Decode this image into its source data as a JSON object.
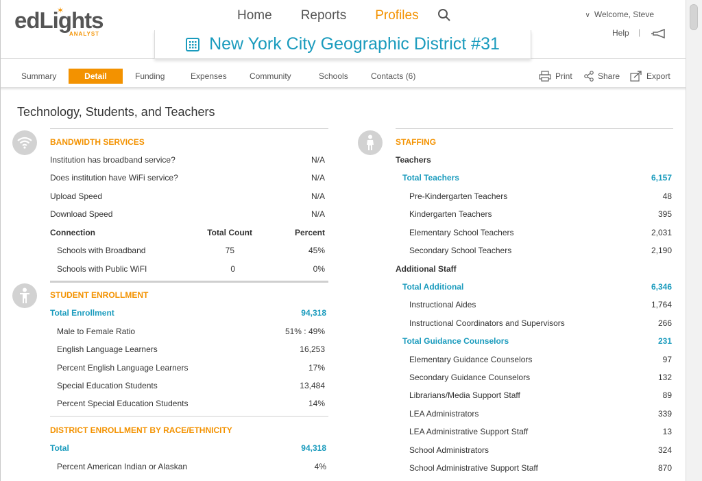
{
  "logo": {
    "main": "edLights",
    "sub": "ANALYST"
  },
  "topnav": {
    "items": [
      "Home",
      "Reports",
      "Profiles"
    ],
    "active": "Profiles"
  },
  "user": {
    "welcome": "Welcome, Steve",
    "help": "Help",
    "separator": "|"
  },
  "page_title": "New York City Geographic District #31",
  "subnav": {
    "tabs": [
      "Summary",
      "Detail",
      "Funding",
      "Expenses",
      "Community",
      "Schools",
      "Contacts (6)"
    ],
    "active": "Detail",
    "actions": [
      "Print",
      "Share",
      "Export"
    ]
  },
  "section_title": "Technology, Students, and Teachers",
  "bandwidth": {
    "heading": "BANDWIDTH SERVICES",
    "rows": [
      {
        "label": "Institution has broadband service?",
        "value": "N/A"
      },
      {
        "label": "Does institution have WiFi service?",
        "value": "N/A"
      },
      {
        "label": "Upload Speed",
        "value": "N/A"
      },
      {
        "label": "Download Speed",
        "value": "N/A"
      }
    ],
    "connection_header": {
      "label": "Connection",
      "count": "Total Count",
      "percent": "Percent"
    },
    "connection_rows": [
      {
        "label": "Schools with Broadband",
        "count": "75",
        "percent": "45%"
      },
      {
        "label": "Schools with Public WiFI",
        "count": "0",
        "percent": "0%"
      }
    ]
  },
  "enrollment": {
    "heading": "STUDENT ENROLLMENT",
    "total": {
      "label": "Total Enrollment",
      "value": "94,318"
    },
    "rows": [
      {
        "label": "Male to Female Ratio",
        "value": "51% : 49%"
      },
      {
        "label": "English Language Learners",
        "value": "16,253"
      },
      {
        "label": "Percent English Language Learners",
        "value": "17%"
      },
      {
        "label": "Special Education Students",
        "value": "13,484"
      },
      {
        "label": "Percent Special Education Students",
        "value": "14%"
      }
    ]
  },
  "race": {
    "heading": "DISTRICT ENROLLMENT BY RACE/ETHNICITY",
    "total": {
      "label": "Total",
      "value": "94,318"
    },
    "rows": [
      {
        "label": "Percent American Indian or Alaskan",
        "value": "4%"
      }
    ]
  },
  "staffing": {
    "heading": "STAFFING",
    "teachers_label": "Teachers",
    "total_teachers": {
      "label": "Total Teachers",
      "value": "6,157"
    },
    "teacher_rows": [
      {
        "label": "Pre-Kindergarten Teachers",
        "value": "48"
      },
      {
        "label": "Kindergarten Teachers",
        "value": "395"
      },
      {
        "label": "Elementary School Teachers",
        "value": "2,031"
      },
      {
        "label": "Secondary School Teachers",
        "value": "2,190"
      }
    ],
    "additional_label": "Additional Staff",
    "total_additional": {
      "label": "Total Additional",
      "value": "6,346"
    },
    "additional_rows": [
      {
        "label": "Instructional Aides",
        "value": "1,764"
      },
      {
        "label": "Instructional Coordinators and Supervisors",
        "value": "266"
      }
    ],
    "total_guidance": {
      "label": "Total Guidance Counselors",
      "value": "231"
    },
    "guidance_rows": [
      {
        "label": "Elementary Guidance Counselors",
        "value": "97"
      },
      {
        "label": "Secondary Guidance Counselors",
        "value": "132"
      },
      {
        "label": "Librarians/Media Support Staff",
        "value": "89"
      },
      {
        "label": "LEA Administrators",
        "value": "339"
      },
      {
        "label": "LEA Administrative Support Staff",
        "value": "13"
      },
      {
        "label": "School Administrators",
        "value": "324"
      },
      {
        "label": "School Administrative Support Staff",
        "value": "870"
      }
    ]
  },
  "colors": {
    "accent": "#f39200",
    "teal": "#1a9bbd",
    "icon_bg": "#d2d2d2"
  }
}
